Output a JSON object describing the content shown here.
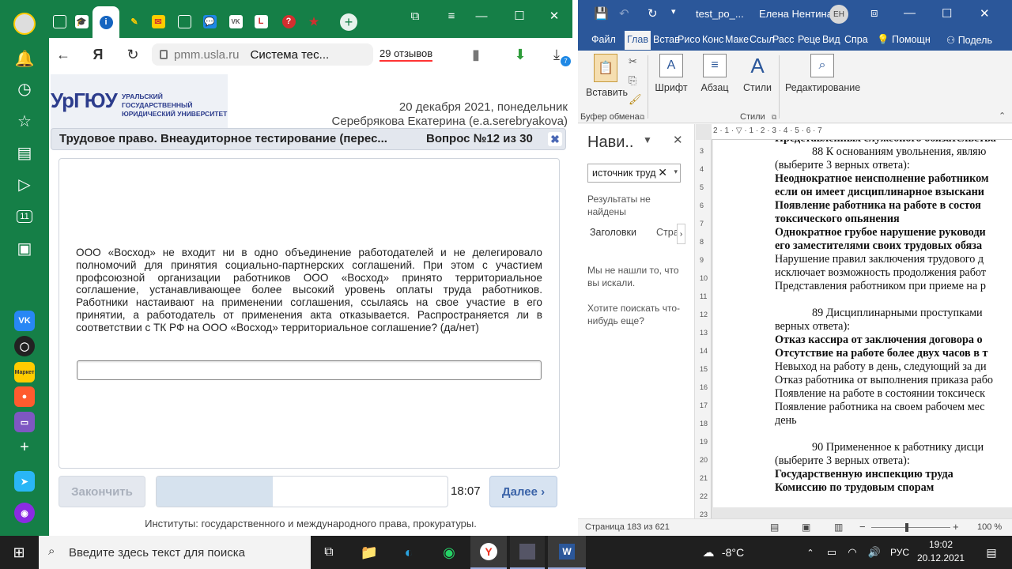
{
  "colors": {
    "yandex_green": "#157f47",
    "word_blue": "#2b579a",
    "taskbar": "#1f1f1f"
  },
  "sidebar": {
    "icons": [
      "avatar-icon",
      "bell-icon",
      "clock-icon",
      "star-icon",
      "collections-icon",
      "play-icon",
      "eleven-icon",
      "gallery-icon"
    ],
    "apps": [
      {
        "name": "vk-app",
        "label": "VK",
        "color": "#2787f5"
      },
      {
        "name": "alice-circle-app",
        "label": "◯",
        "color": "#222"
      },
      {
        "name": "market-app",
        "label": "Маркет",
        "color": "#ffcc00"
      },
      {
        "name": "eda-app",
        "label": "●",
        "color": "#ff5b2e"
      },
      {
        "name": "disk-app",
        "label": "▭",
        "color": "#7e57c2"
      },
      {
        "name": "add-app",
        "label": "+",
        "color": "transparent"
      },
      {
        "name": "send-app",
        "label": "➤",
        "color": "#29b6f6"
      },
      {
        "name": "alice-app",
        "label": "◉",
        "color": "#8a2be2"
      }
    ]
  },
  "browser": {
    "tabs": [
      "new-tab",
      "degree-tab",
      "info-tab",
      "wand-tab",
      "mail-tab",
      "doc-tab",
      "chat-tab",
      "vk-tab",
      "l-tab",
      "red-tab",
      "star-tab"
    ],
    "url_host": "pmm.usla.ru",
    "page_title": "Система тес...",
    "reviews": "29 отзывов",
    "download_badge": "7"
  },
  "page": {
    "logo_text": "УрГЮУ",
    "logo_subtitle": "УРАЛЬСКИЙ ГОСУДАРСТВЕННЫЙ ЮРИДИЧЕСКИЙ УНИВЕРСИТЕТ",
    "date": "20 декабря 2021, понедельник",
    "user": "Серебрякова Екатерина (e.a.serebryakova)",
    "test_title": "Трудовое право. Внеаудиторное тестирование (перес...",
    "question_number": "Вопрос №12 из 30",
    "close_label": "✖",
    "question_text": "ООО «Восход» не входит ни в одно объединение работодателей и не делегировало полномочий для принятия социально-партнерских соглашений. При этом с участием профсоюзной организации работников ООО «Восход» принято территориальное соглашение, устанавливающее более высокий уровень оплаты труда работников. Работники настаивают на применении соглашения, ссылаясь на свое участие в его принятии, а работодатель от применения акта отказывается. Распространяется ли в соответствии с ТК РФ на ООО «Восход» территориальное соглашение? (да/нет)",
    "answer_value": "",
    "finish_label": "Закончить",
    "progress": 0.4,
    "timer": "18:07",
    "next_label": "Далее ›",
    "footer": "Институты: государственного и международного права, прокуратуры."
  },
  "word": {
    "filename": "test_po_...",
    "user": "Елена Нентина",
    "avatar": "ЕН",
    "tabs": [
      "Файл",
      "Глав",
      "Встав",
      "Рисо",
      "Конс",
      "Маке",
      "Ссыл",
      "Расс",
      "Реце",
      "Вид",
      "Спра",
      "Помощн",
      "Подель"
    ],
    "ribbon": {
      "paste": "Вставить",
      "font": "Шрифт",
      "paragraph": "Абзац",
      "styles": "Стили",
      "editing": "Редактирование",
      "clipboard_group": "Буфер обмена",
      "styles_group": "Стили"
    },
    "nav": {
      "title": "Нави..",
      "search_value": "источник труд",
      "no_results": "Результаты не найдены",
      "headings_tab": "Заголовки",
      "pages_tab": "Стра",
      "not_found": "Мы не нашли то, что вы искали.",
      "search_more": "Хотите поискать что-нибудь еще?"
    },
    "doc_lines": [
      {
        "text": "Представленных служебного обязательства",
        "style": "b",
        "indent": false
      },
      {
        "text": "88 К основаниям увольнения, являю",
        "style": "",
        "indent": true
      },
      {
        "text": "(выберите 3 верных ответа):",
        "style": "",
        "indent": false
      },
      {
        "text": "Неоднократное неисполнение работником",
        "style": "b",
        "indent": false
      },
      {
        "text": "если он имеет дисциплинарное взыскани",
        "style": "b",
        "indent": false
      },
      {
        "text": "Появление работника на работе в состоя",
        "style": "b",
        "indent": false
      },
      {
        "text": "токсического опьянения",
        "style": "b",
        "indent": false
      },
      {
        "text": "Однократное грубое нарушение руководи",
        "style": "b",
        "indent": false
      },
      {
        "text": "его заместителями своих трудовых обяза",
        "style": "b",
        "indent": false
      },
      {
        "text": "Нарушение правил заключения трудового д",
        "style": "",
        "indent": false
      },
      {
        "text": "исключает возможность продолжения работ",
        "style": "",
        "indent": false
      },
      {
        "text": "Представления работником при приеме на р",
        "style": "",
        "indent": false
      },
      {
        "text": "",
        "style": "gap",
        "indent": false
      },
      {
        "text": "89 Дисциплинарными проступками",
        "style": "",
        "indent": true
      },
      {
        "text": "верных ответа):",
        "style": "",
        "indent": false
      },
      {
        "text": "Отказ кассира от заключения договора о",
        "style": "b",
        "indent": false
      },
      {
        "text": "Отсутствие на работе более двух часов в т",
        "style": "b",
        "indent": false
      },
      {
        "text": "Невыход на работу в день, следующий за ди",
        "style": "",
        "indent": false
      },
      {
        "text": "Отказ работника от выполнения приказа рабо",
        "style": "",
        "indent": false
      },
      {
        "text": "Появление на работе в состоянии токсическ",
        "style": "",
        "indent": false
      },
      {
        "text": "Появление работника на своем рабочем мес",
        "style": "",
        "indent": false
      },
      {
        "text": "день",
        "style": "",
        "indent": false
      },
      {
        "text": "",
        "style": "gap",
        "indent": false
      },
      {
        "text": "90 Примененное к работнику дисци",
        "style": "",
        "indent": true
      },
      {
        "text": "(выберите 3 верных ответа):",
        "style": "",
        "indent": false
      },
      {
        "text": "Государственную инспекцию труда",
        "style": "b",
        "indent": false
      },
      {
        "text": "Комиссию по трудовым спорам",
        "style": "b",
        "indent": false
      }
    ],
    "status_page": "Страница 183 из 621",
    "zoom": "100 %"
  },
  "taskbar": {
    "search_placeholder": "Введите здесь текст для поиска",
    "weather": "-8°C",
    "lang": "РУС",
    "time": "19:02",
    "date": "20.12.2021"
  }
}
